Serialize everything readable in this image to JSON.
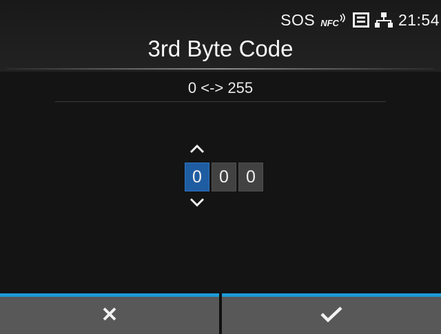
{
  "status_bar": {
    "sos_label": "SOS",
    "nfc_label": "NFC",
    "time": "21:54",
    "icons": [
      "nfc-icon",
      "sd-card-icon",
      "network-icon"
    ]
  },
  "header": {
    "title": "3rd Byte Code"
  },
  "range": {
    "text": "0 <-> 255"
  },
  "spinner": {
    "digits": [
      "0",
      "0",
      "0"
    ],
    "selected_index": 0,
    "up_icon": "chevron-up-icon",
    "down_icon": "chevron-down-icon"
  },
  "footer": {
    "cancel_icon": "x-icon",
    "confirm_icon": "checkmark-icon"
  },
  "colors": {
    "accent": "#1f9ad6",
    "selected_digit": "#1f5da2",
    "button_bg": "#585858"
  }
}
